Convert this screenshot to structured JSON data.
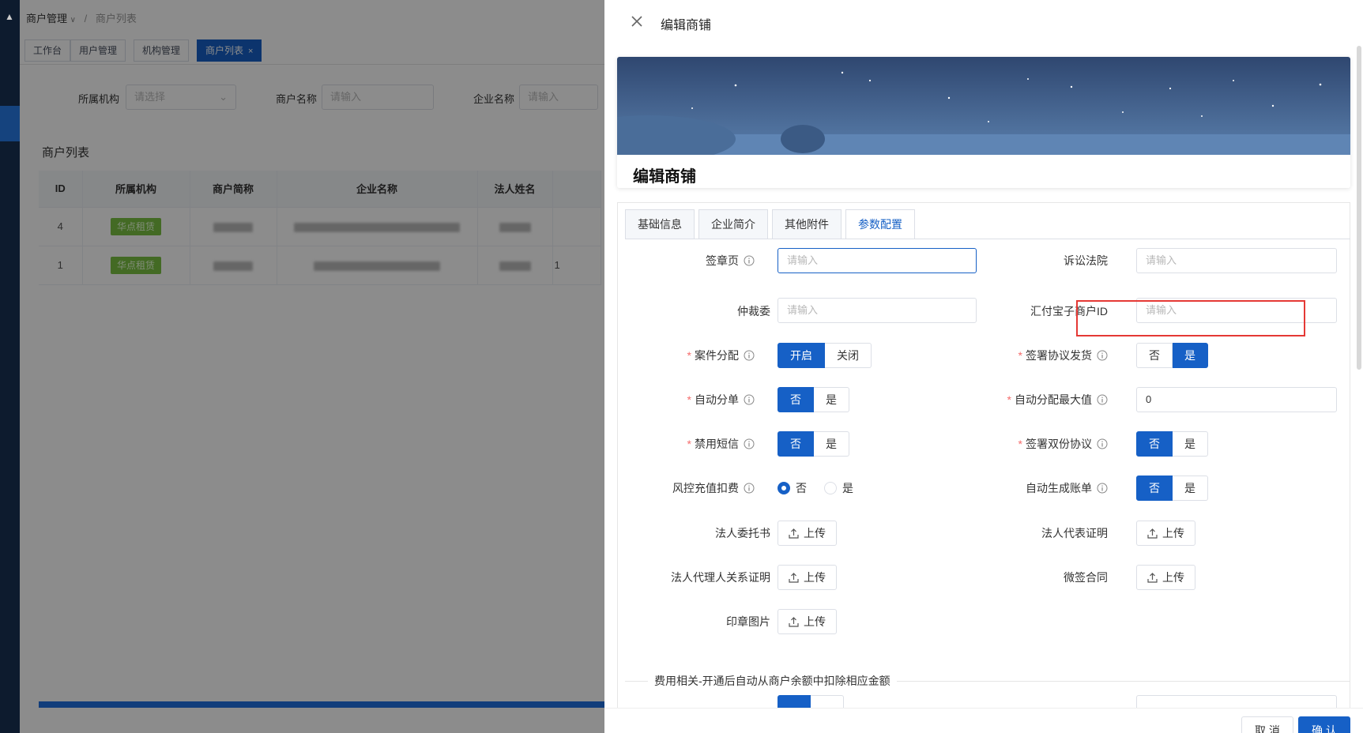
{
  "app": {
    "breadcrumb": {
      "parent": "商户管理",
      "current": "商户列表"
    },
    "tabs": [
      {
        "label": "工作台"
      },
      {
        "label": "用户管理"
      },
      {
        "label": "机构管理"
      },
      {
        "label": "商户列表",
        "close": "×"
      }
    ],
    "search": {
      "org_label": "所属机构",
      "org_placeholder": "请选择",
      "name_label": "商户名称",
      "name_placeholder": "请输入",
      "company_label": "企业名称",
      "company_placeholder": "请输入"
    },
    "list": {
      "title": "商户列表",
      "columns": [
        "ID",
        "所属机构",
        "商户简称",
        "企业名称",
        "法人姓名"
      ],
      "rows": [
        {
          "id": "4",
          "org": "华点租赁"
        },
        {
          "id": "1",
          "org": "华点租赁"
        }
      ],
      "row2_extra": "1"
    }
  },
  "drawer": {
    "title": "编辑商铺",
    "shop_name": "编辑商铺",
    "tabs": [
      "基础信息",
      "企业简介",
      "其他附件",
      "参数配置"
    ],
    "active_tab": "参数配置",
    "fields": {
      "sign_page": {
        "label": "签章页",
        "placeholder": "请输入"
      },
      "court": {
        "label": "诉讼法院",
        "placeholder": "请输入"
      },
      "arbitration": {
        "label": "仲裁委",
        "placeholder": "请输入"
      },
      "huifubao_id": {
        "label": "汇付宝子商户ID",
        "placeholder": "请输入"
      },
      "case_assign": {
        "label": "案件分配",
        "options": [
          "开启",
          "关闭"
        ],
        "selected": "开启"
      },
      "sign_agreement_ship": {
        "label": "签署协议发货",
        "options": [
          "否",
          "是"
        ],
        "selected": "是"
      },
      "auto_split": {
        "label": "自动分单",
        "options": [
          "否",
          "是"
        ],
        "selected": "否"
      },
      "auto_assign_max": {
        "label": "自动分配最大值",
        "value": "0"
      },
      "disable_sms": {
        "label": "禁用短信",
        "options": [
          "否",
          "是"
        ],
        "selected": "否"
      },
      "dual_agreement": {
        "label": "签署双份协议",
        "options": [
          "否",
          "是"
        ],
        "selected": "否"
      },
      "risk_fee": {
        "label": "风控充值扣费",
        "options": [
          "否",
          "是"
        ],
        "selected": "否"
      },
      "auto_bill": {
        "label": "自动生成账单",
        "options": [
          "否",
          "是"
        ],
        "selected": "否"
      },
      "legal_entrust": {
        "label": "法人委托书",
        "button": "上传"
      },
      "legal_rep_cert": {
        "label": "法人代表证明",
        "button": "上传"
      },
      "legal_agent_cert": {
        "label": "法人代理人关系证明",
        "button": "上传"
      },
      "micro_contract": {
        "label": "微签合同",
        "button": "上传"
      },
      "seal_image": {
        "label": "印章图片",
        "button": "上传"
      }
    },
    "fee_section": "费用相关-开通后自动从商户余额中扣除相应金额",
    "footer": {
      "cancel": "取 消",
      "confirm": "确 认"
    }
  },
  "colors": {
    "primary": "#1660c6",
    "required": "#f56c6c",
    "highlight": "#e53935",
    "tag_green": "#7ac143"
  }
}
